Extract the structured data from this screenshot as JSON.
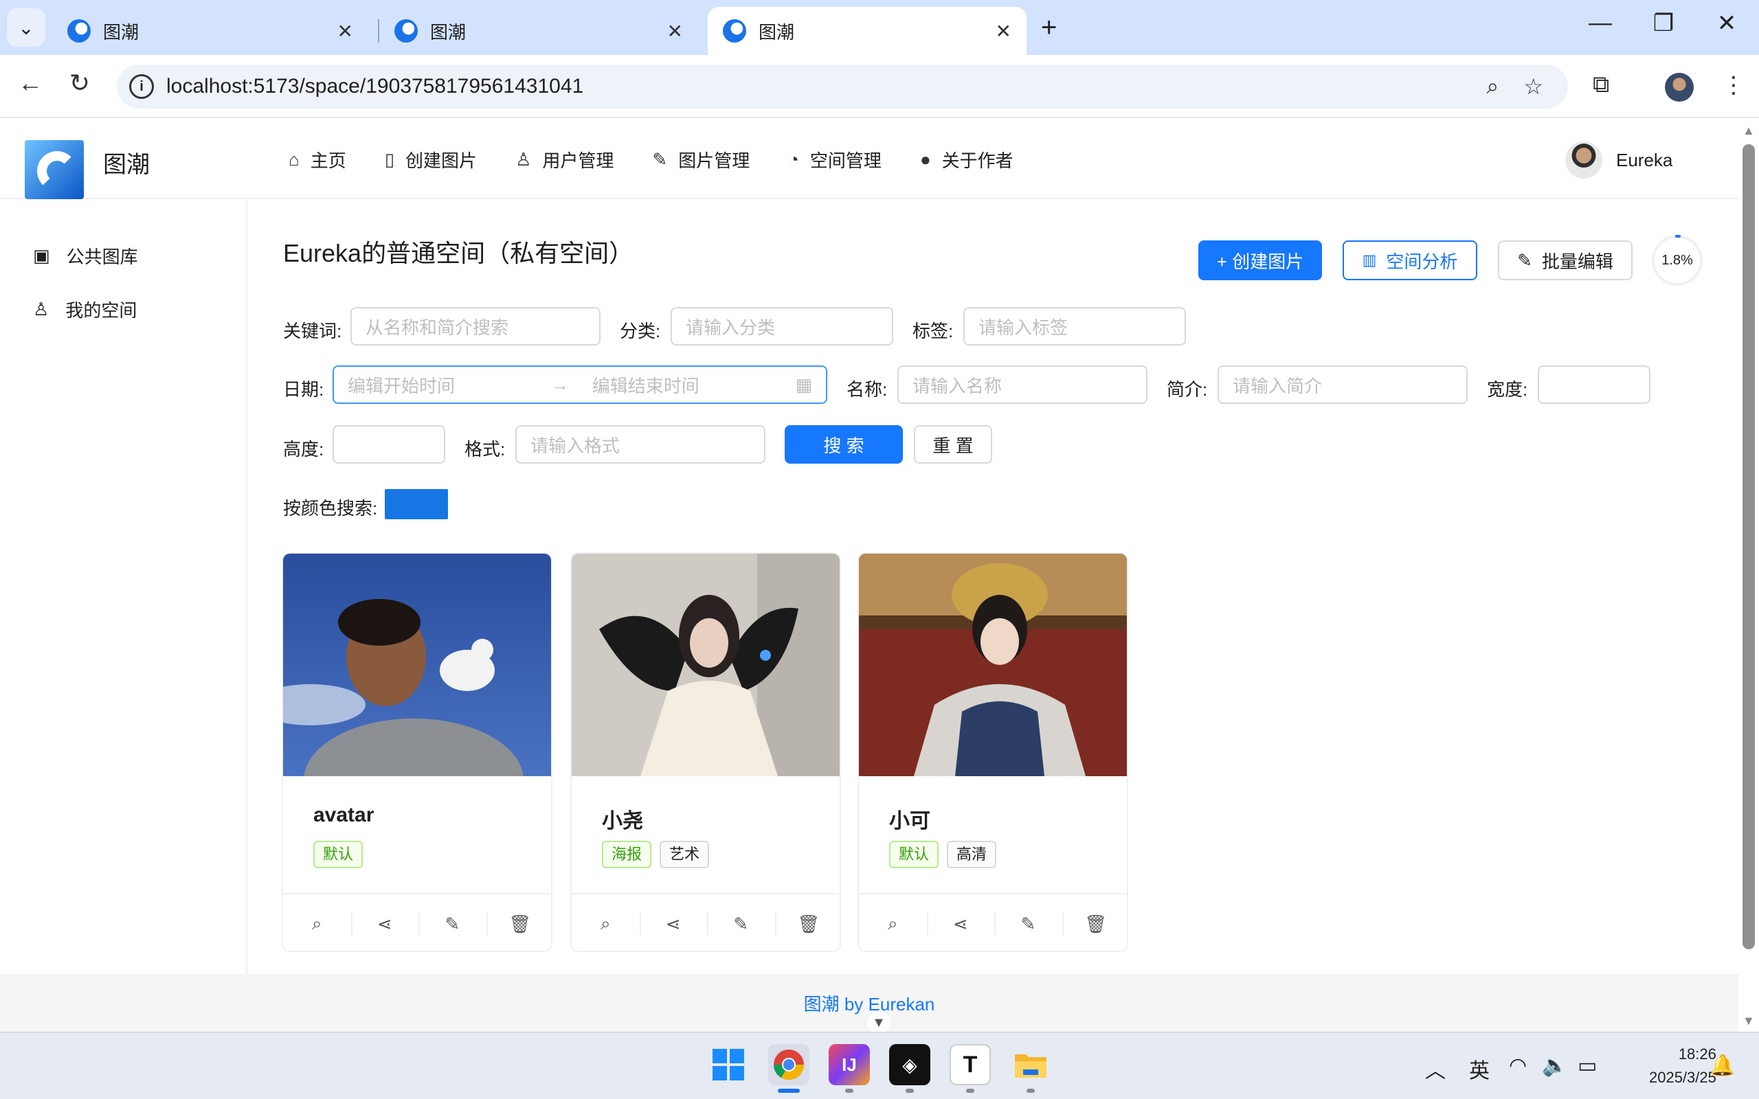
{
  "browser": {
    "tabs": [
      {
        "title": "图潮"
      },
      {
        "title": "图潮"
      },
      {
        "title": "图潮"
      }
    ],
    "url": "localhost:5173/space/1903758179561431041"
  },
  "app": {
    "name": "图潮",
    "menu": [
      {
        "label": "主页",
        "icon": "home-icon",
        "glyph": "⌂"
      },
      {
        "label": "创建图片",
        "icon": "file-add-icon",
        "glyph": "🗋"
      },
      {
        "label": "用户管理",
        "icon": "user-icon",
        "glyph": "👤"
      },
      {
        "label": "图片管理",
        "icon": "edit-icon",
        "glyph": "✎"
      },
      {
        "label": "空间管理",
        "icon": "pie-chart-icon",
        "glyph": "◔"
      },
      {
        "label": "关于作者",
        "icon": "github-icon",
        "glyph": "⊙"
      }
    ],
    "username": "Eureka"
  },
  "sidebar": {
    "items": [
      {
        "label": "公共图库",
        "icon": "picture-icon"
      },
      {
        "label": "我的空间",
        "icon": "user-icon"
      }
    ]
  },
  "page": {
    "title": "Eureka的普通空间（私有空间）",
    "buttons": {
      "create": "+ 创建图片",
      "analyze": "空间分析",
      "batch_edit": "批量编辑"
    },
    "usage_percent": "1.8%"
  },
  "filters": {
    "keyword": {
      "label": "关键词:",
      "placeholder": "从名称和简介搜索"
    },
    "category": {
      "label": "分类:",
      "placeholder": "请输入分类"
    },
    "tags": {
      "label": "标签:",
      "placeholder": "请输入标签"
    },
    "date": {
      "label": "日期:",
      "start_placeholder": "编辑开始时间",
      "end_placeholder": "编辑结束时间"
    },
    "name": {
      "label": "名称:",
      "placeholder": "请输入名称"
    },
    "intro": {
      "label": "简介:",
      "placeholder": "请输入简介"
    },
    "width": {
      "label": "宽度:",
      "placeholder": ""
    },
    "height": {
      "label": "高度:",
      "placeholder": ""
    },
    "format": {
      "label": "格式:",
      "placeholder": "请输入格式"
    },
    "search_button": "搜 索",
    "reset_button": "重 置",
    "color_label": "按颜色搜索:",
    "color_value": "#1677e4"
  },
  "pictures": [
    {
      "name": "avatar",
      "tags": [
        {
          "text": "默认",
          "style": "green"
        }
      ]
    },
    {
      "name": "小尧",
      "tags": [
        {
          "text": "海报",
          "style": "green"
        },
        {
          "text": "艺术",
          "style": "default"
        }
      ]
    },
    {
      "name": "小可",
      "tags": [
        {
          "text": "默认",
          "style": "green"
        },
        {
          "text": "高清",
          "style": "default"
        }
      ]
    }
  ],
  "footer": {
    "text": "图潮 by Eurekan"
  },
  "system": {
    "ime": "英",
    "time": "18:26",
    "date": "2025/3/25"
  }
}
